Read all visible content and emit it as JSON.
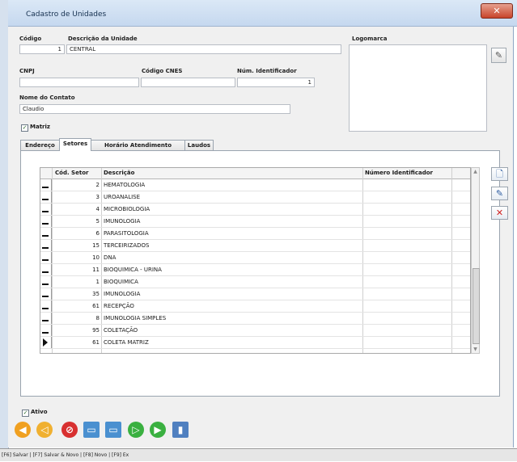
{
  "window": {
    "title": "Cadastro de Unidades",
    "close_label": "✕"
  },
  "form": {
    "codigo_label": "Código",
    "codigo_value": "1",
    "descricao_label": "Descrição da Unidade",
    "descricao_value": "CENTRAL",
    "logomarca_label": "Logomarca",
    "cnpj_label": "CNPJ",
    "cnpj_value": "",
    "cnes_label": "Código CNES",
    "cnes_value": "",
    "num_ident_label": "Núm. Identificador",
    "num_ident_value": "1",
    "contato_label": "Nome do Contato",
    "contato_value": "Claudio",
    "matriz_label": "Matriz",
    "matriz_checked": true,
    "ativo_label": "Ativo",
    "ativo_checked": true
  },
  "tabs": [
    {
      "label": "Endereço",
      "active": false
    },
    {
      "label": "Setores",
      "active": true
    },
    {
      "label": "Horário Atendimento",
      "active": false
    },
    {
      "label": "Laudos",
      "active": false
    }
  ],
  "grid": {
    "columns": [
      "Cód. Setor",
      "Descrição",
      "Número Identificador"
    ],
    "rows": [
      {
        "codigo": "2",
        "descricao": "HEMATOLOGIA"
      },
      {
        "codigo": "3",
        "descricao": "UROANALISE"
      },
      {
        "codigo": "4",
        "descricao": "MICROBIOLOGIA"
      },
      {
        "codigo": "5",
        "descricao": "IMUNOLOGIA"
      },
      {
        "codigo": "6",
        "descricao": "PARASITOLOGIA"
      },
      {
        "codigo": "15",
        "descricao": "TERCEIRIZADOS"
      },
      {
        "codigo": "10",
        "descricao": "DNA"
      },
      {
        "codigo": "11",
        "descricao": "BIOQUIMICA - URINA"
      },
      {
        "codigo": "1",
        "descricao": "BIOQUIMICA"
      },
      {
        "codigo": "35",
        "descricao": "IMUNOLOGIA"
      },
      {
        "codigo": "61",
        "descricao": "RECEPÇÃO"
      },
      {
        "codigo": "8",
        "descricao": "IMUNOLOGIA SIMPLES"
      },
      {
        "codigo": "95",
        "descricao": "COLETAÇÃO"
      },
      {
        "codigo": "61",
        "descricao": "COLETA MATRIZ"
      }
    ],
    "current_row_index": 13
  },
  "side_buttons": [
    {
      "name": "new-record-icon",
      "glyph": "🗋"
    },
    {
      "name": "edit-record-icon",
      "glyph": "✎"
    },
    {
      "name": "delete-record-icon",
      "glyph": "✕"
    }
  ],
  "toolbar": [
    {
      "name": "first-record-icon",
      "color": "#f0a020"
    },
    {
      "name": "previous-record-icon",
      "color": "#f0b030"
    },
    {
      "name": "cancel-icon",
      "color": "#d83030"
    },
    {
      "name": "new-icon",
      "color": "#4a90d0"
    },
    {
      "name": "save-icon",
      "color": "#4a90d0"
    },
    {
      "name": "next-record-icon",
      "color": "#3ab040"
    },
    {
      "name": "last-record-icon",
      "color": "#3ab040"
    },
    {
      "name": "exit-icon",
      "color": "#5080c0"
    }
  ],
  "statusbar": {
    "text": "[F6] Salvar | [F7] Salvar & Novo | [F8] Novo | [F9] Ex"
  },
  "colors": {
    "accent": "#c5d8ef",
    "close": "#c8442a"
  }
}
